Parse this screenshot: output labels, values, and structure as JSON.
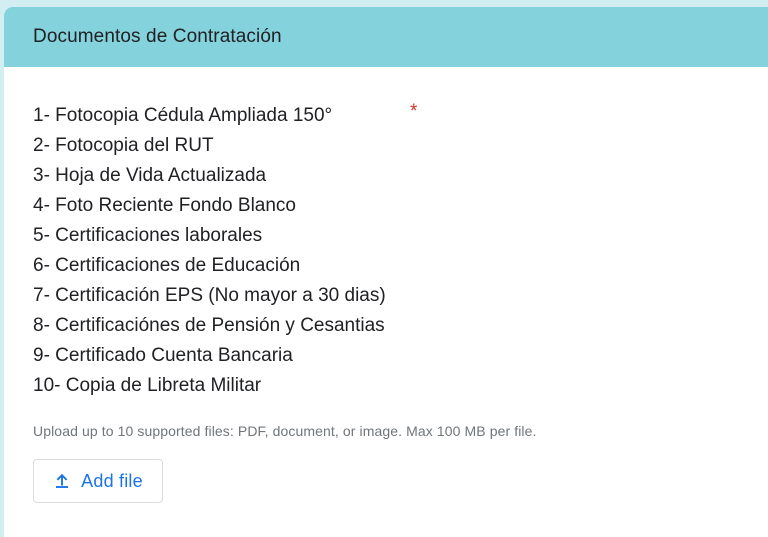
{
  "section": {
    "title": "Documentos de Contratación"
  },
  "question": {
    "items": [
      "1- Fotocopia Cédula Ampliada 150°",
      "2- Fotocopia del RUT",
      "3- Hoja de Vida Actualizada",
      "4- Foto Reciente Fondo Blanco",
      "5- Certificaciones laborales",
      "6- Certificaciones de Educación",
      "7- Certificación EPS (No mayor a 30 dias)",
      "8- Certificaciónes de Pensión y Cesantias",
      "9- Certificado Cuenta Bancaria",
      "10- Copia de Libreta Militar"
    ],
    "required_marker": "*",
    "upload_hint": "Upload up to 10 supported files: PDF, document, or image. Max 100 MB per file.",
    "add_file_label": "Add file",
    "add_file_icon": "upload-icon"
  },
  "colors": {
    "header_bg": "#84d2dc",
    "page_bg": "#d3eef2",
    "accent": "#1a73e8",
    "required": "#d93025"
  }
}
